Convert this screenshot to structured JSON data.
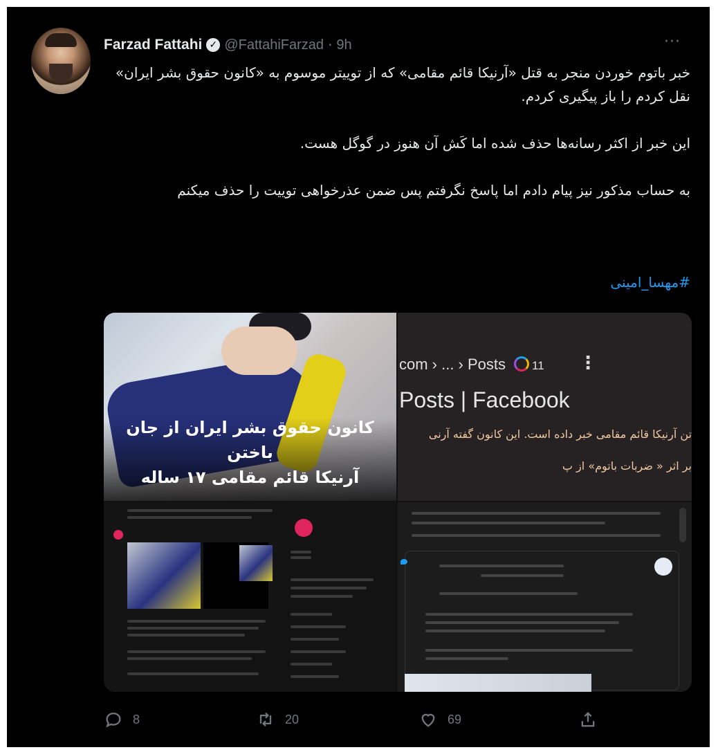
{
  "tweet": {
    "author_name": "Farzad Fattahi",
    "handle": "@FattahiFarzad",
    "separator": "·",
    "time": "9h",
    "more": "···",
    "paragraphs": [
      "خبر باتوم خوردن منجر به قتل «آرنیکا قائم مقامی» که از توییتر موسوم به «کانون حقوق بشر ایران» نقل کردم را باز پیگیری کردم.",
      "این خبر از اکثر رسانه‌ها حذف شده اما کَش آن هنوز در گوگل هست.",
      "به حساب مذکور نیز پیام دادم اما پاسخ نگرفتم پس ضمن عذرخواهی توییت را حذف میکنم"
    ],
    "hashtag": "#مهسا_امینی"
  },
  "media": {
    "image1_caption_line1": "کانون حقوق بشر ایران از جان باختن",
    "image1_caption_line2": "آرنیکا قائم مقامی ۱۷ ساله",
    "search_breadcrumb": "com › ... › Posts",
    "search_count": "11",
    "search_title": "Posts | Facebook",
    "snippet_line1": "تن آرنیکا قائم مقامی خبر داده است. این کانون گفته آرنی",
    "snippet_line2": "بر اثر « ضربات باتوم» از پ"
  },
  "actions": {
    "replies": "8",
    "retweets": "20",
    "likes": "69"
  },
  "colors": {
    "background": "#000000",
    "text": "#e7e9ea",
    "muted": "#71767b",
    "link": "#1d9bf0"
  },
  "icons": [
    "verified-badge-icon",
    "more-icon",
    "reply-icon",
    "retweet-icon",
    "like-icon",
    "share-icon"
  ]
}
